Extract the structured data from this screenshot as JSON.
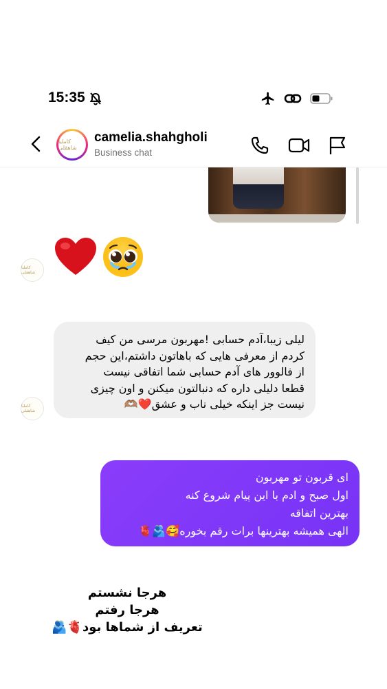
{
  "status_bar": {
    "time": "15:35",
    "icons": [
      "bell-muted-icon",
      "airplane-icon",
      "link-icon",
      "battery-icon"
    ]
  },
  "header": {
    "username": "camelia.shahgholi",
    "subtitle": "Business chat",
    "avatar_text": "کاملیا شاهقلی",
    "actions": [
      "phone-icon",
      "video-icon",
      "flag-icon"
    ]
  },
  "messages": {
    "emoji_message": "❤️🥹",
    "incoming_lines": [
      "لیلی زیبا،آدم حسابی !مهربون مرسی من کیف",
      "کردم از معرفی هایی که باهاتون داشتم،این حجم",
      "از فالوور های آدم حسابی شما اتفاقی نیست",
      "قطعا دلیلی داره که دنبالتون میکنن و اون چیزی",
      "نیست جز اینکه خیلی ناب و عشق❤️🫶🏽"
    ],
    "outgoing_lines": [
      "ای قربون تو مهربون",
      "اول صبح و ادم با این پیام شروع کنه",
      "بهترین اتفاقه",
      "الهی همیشه بهترینها برات رقم بخوره🥰🫂🫀"
    ],
    "sender_avatar_text": "کاملیا شاهقلی"
  },
  "caption_lines": [
    "هرجا نشستم",
    "هرجا رفتم",
    "تعریف از شماها بود🫀🫂"
  ],
  "colors": {
    "outgoing_bubble": "#7f38f8",
    "incoming_bubble": "#efefef",
    "subtitle": "#737373"
  }
}
